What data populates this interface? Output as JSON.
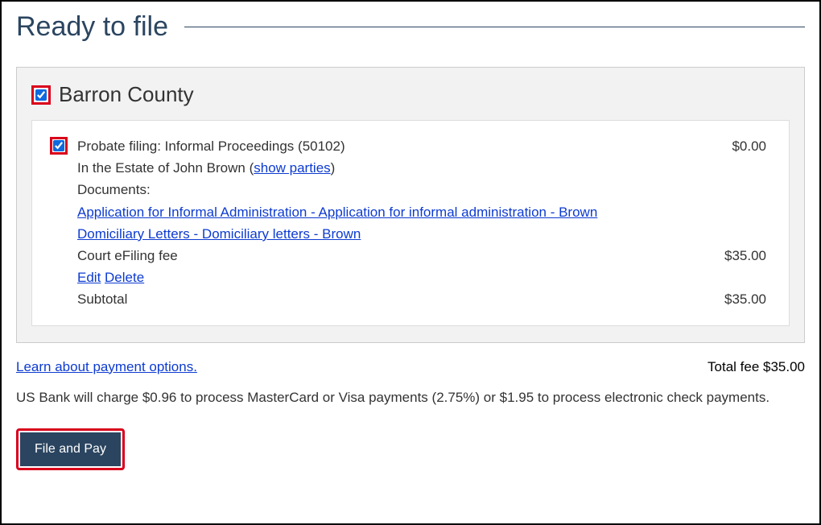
{
  "title": "Ready to file",
  "county": {
    "checked": true,
    "name": "Barron County"
  },
  "filing": {
    "checked": true,
    "line1": "Probate filing: Informal Proceedings (50102)",
    "line1_amount": "$0.00",
    "estate_text": "In the Estate of John Brown  (",
    "show_parties": "show parties",
    "estate_close": ")",
    "documents_label": "Documents:",
    "doc1": "Application for Informal Administration - Application for informal administration - Brown",
    "doc2": "Domiciliary Letters - Domiciliary letters - Brown",
    "efiling_label": "Court eFiling fee",
    "efiling_amount": "$35.00",
    "edit_label": "Edit",
    "delete_label": "Delete",
    "subtotal_label": "Subtotal",
    "subtotal_amount": "$35.00"
  },
  "footer": {
    "learn_link": "Learn about payment options.",
    "total_label": "Total fee $35.00",
    "bank_note": "US Bank will charge $0.96 to process MasterCard or Visa payments (2.75%) or $1.95 to process electronic check payments.",
    "button_label": "File and Pay"
  }
}
